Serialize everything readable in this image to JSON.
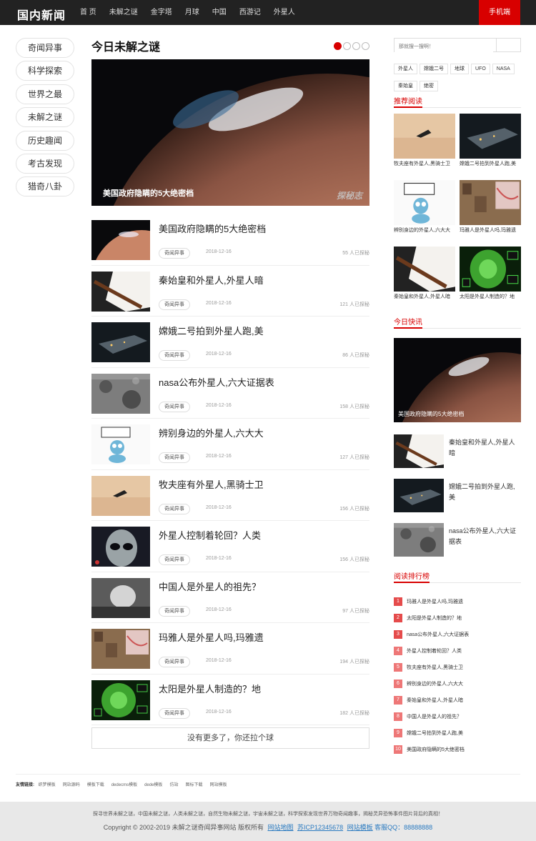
{
  "header": {
    "logo": "国内新闻",
    "nav": [
      "首 页",
      "未解之谜",
      "金字塔",
      "月球",
      "中国",
      "西游记",
      "外星人"
    ],
    "mobile": "手机端"
  },
  "leftnav": [
    "奇闻异事",
    "科学探索",
    "世界之最",
    "未解之谜",
    "历史趣闻",
    "考古发现",
    "猎奇八卦"
  ],
  "main": {
    "title": "今日未解之谜",
    "hero_caption": "美国政府隐瞒的5大绝密档",
    "hero_watermark": "探秘志",
    "items": [
      {
        "title": "美国政府隐瞒的5大绝密档",
        "tag": "奇闻异事",
        "date": "2018-12-16",
        "reads": "55 人已探秘",
        "img": "mars"
      },
      {
        "title": "秦始皇和外星人,外星人暗",
        "tag": "奇闻异事",
        "date": "2018-12-16",
        "reads": "121 人已探秘",
        "img": "pen"
      },
      {
        "title": "嫦娥二号拍到外星人跑,美",
        "tag": "奇闻异事",
        "date": "2018-12-16",
        "reads": "86 人已探秘",
        "img": "ship"
      },
      {
        "title": "nasa公布外星人,六大证据表",
        "tag": "奇闻异事",
        "date": "2018-12-16",
        "reads": "158 人已探秘",
        "img": "moon"
      },
      {
        "title": "辨别身边的外星人,六大大",
        "tag": "奇闻异事",
        "date": "2018-12-16",
        "reads": "127 人已探秘",
        "img": "alien"
      },
      {
        "title": "牧夫座有外星人,黑骑士卫",
        "tag": "奇闻异事",
        "date": "2018-12-16",
        "reads": "156 人已探秘",
        "img": "sand"
      },
      {
        "title": "外星人控制着轮回？人类",
        "tag": "奇闻异事",
        "date": "2018-12-16",
        "reads": "156 人已探秘",
        "img": "grey"
      },
      {
        "title": "中国人是外星人的祖先？",
        "tag": "奇闻异事",
        "date": "2018-12-16",
        "reads": "97 人已探秘",
        "img": "skull"
      },
      {
        "title": "玛雅人是外星人吗,玛雅遗",
        "tag": "奇闻异事",
        "date": "2018-12-16",
        "reads": "194 人已探秘",
        "img": "maya"
      },
      {
        "title": "太阳是外星人制造的？地",
        "tag": "奇闻异事",
        "date": "2018-12-16",
        "reads": "182 人已探秘",
        "img": "sun"
      }
    ],
    "more": "没有更多了，你还拉个球"
  },
  "sidebar": {
    "search_placeholder": "那就搜一搜啊！",
    "tags": [
      "外星人",
      "嫦娥二号",
      "地球",
      "UFO",
      "NASA",
      "秦始皇",
      "绝密"
    ],
    "rec_title": "推荐阅读",
    "rec": [
      {
        "title": "牧夫座有外星人,黑骑士卫",
        "img": "sand"
      },
      {
        "title": "嫦娥二号拍到外星人跑,美",
        "img": "ship"
      },
      {
        "title": "辨别身边的外星人,六大大",
        "img": "alien"
      },
      {
        "title": "玛雅人是外星人吗,玛雅遗",
        "img": "maya"
      },
      {
        "title": "秦始皇和外星人,外星人暗",
        "img": "pen"
      },
      {
        "title": "太阳是外星人制造的？地",
        "img": "sun"
      }
    ],
    "quick_title": "今日快讯",
    "quick_hero_caption": "美国政府隐瞒的5大绝密档",
    "quick": [
      {
        "title": "秦始皇和外星人,外星人暗",
        "img": "pen"
      },
      {
        "title": "嫦娥二号拍到外星人跑,美",
        "img": "ship"
      },
      {
        "title": "nasa公布外星人,六大证据表",
        "img": "moon"
      }
    ],
    "rank_title": "阅读排行榜",
    "rank": [
      "玛雅人是外星人吗,玛雅遗",
      "太阳是外星人制造的？地",
      "nasa公布外星人,六大证据表",
      "外星人控制着轮回？人类",
      "牧夫座有外星人,黑骑士卫",
      "辨别身边的外星人,六大大",
      "秦始皇和外星人,外星人暗",
      "中国人是外星人的祖先？",
      "嫦娥二号拍到外星人跑,美",
      "美国政府隐瞒的5大绝密档"
    ]
  },
  "friends": {
    "label": "友情链接:",
    "links": [
      "织梦模板",
      "网站源码",
      "模板下载",
      "dedecms模板",
      "dede模板",
      "仿站",
      "图标下载",
      "网站模板"
    ]
  },
  "footer": {
    "line1": "探寻世界未解之谜，中国未解之谜，人类未解之谜，自然生物未解之谜，宇宙未解之谜，科学探索发现世界万物奇闻趣事，揭秘灵异恐怖事件图片背后的真相！",
    "copyright": "Copyright © 2002-2019 未解之谜奇闻异事网站 版权所有",
    "links": [
      "网站地图",
      "苏ICP12345678",
      "网站模板"
    ],
    "qq": "客服QQ：88888888"
  }
}
